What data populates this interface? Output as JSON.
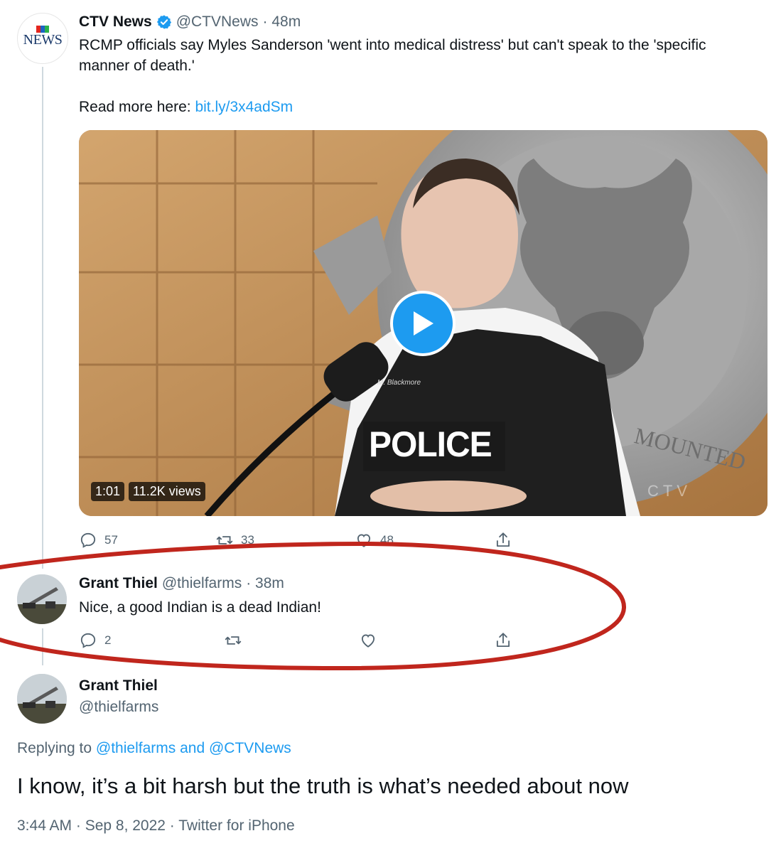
{
  "tweet1": {
    "logo_top": "CTV",
    "logo_bottom": "NEWS",
    "author_name": "CTV News",
    "author_handle": "@CTVNews",
    "time": "· 48m",
    "text_line1": "RCMP officials say Myles Sanderson 'went into medical distress' but can't speak to the 'specific",
    "text_line2": "manner of death.'",
    "read_more_label": "Read more here:",
    "read_more_link": "bit.ly/3x4adSm",
    "video": {
      "duration": "1:01",
      "views": "11.2K views",
      "vest_text": "POLICE",
      "nametag": "M. Blackmore",
      "emblem_text": "MOUNTED",
      "watermark": "CTV"
    },
    "actions": {
      "reply_count": "57",
      "retweet_count": "33",
      "like_count": "48"
    }
  },
  "tweet2": {
    "author_name": "Grant Thiel",
    "author_handle": "@thielfarms",
    "time": "· 38m",
    "text": "Nice, a good Indian is a dead Indian!",
    "actions": {
      "reply_count": "2"
    }
  },
  "main_tweet": {
    "author_name": "Grant Thiel",
    "author_handle": "@thielfarms",
    "replying_label": "Replying to",
    "replying_to": "@thielfarms and @CTVNews",
    "text": "I know, it’s a bit harsh but the truth is what’s needed about now",
    "meta": "3:44 AM · Sep 8, 2022 · Twitter for iPhone"
  },
  "colors": {
    "link_blue": "#1d9bf0",
    "annotation_red": "#c0261d",
    "verified_blue": "#1d9bf0"
  }
}
